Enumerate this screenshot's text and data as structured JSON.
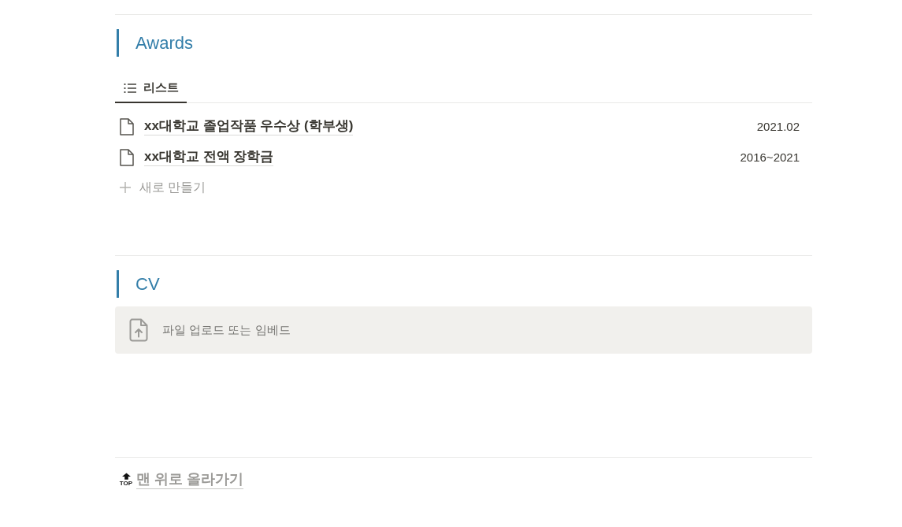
{
  "sections": [
    {
      "kind": "database",
      "title": "Awards",
      "views": [
        {
          "label": "리스트",
          "selected": true
        }
      ],
      "items": [
        {
          "title": "xx대학교 졸업작품 우수상 (학부생)",
          "date": "2021.02"
        },
        {
          "title": "xx대학교 전액 장학금",
          "date": "2016~2021"
        }
      ],
      "new_label": "새로 만들기"
    },
    {
      "kind": "embed",
      "title": "CV",
      "prompt": "파일 업로드 또는 임베드"
    }
  ],
  "back_to_top": {
    "badge": "TOP",
    "label": "맨 위로 올라가기"
  }
}
